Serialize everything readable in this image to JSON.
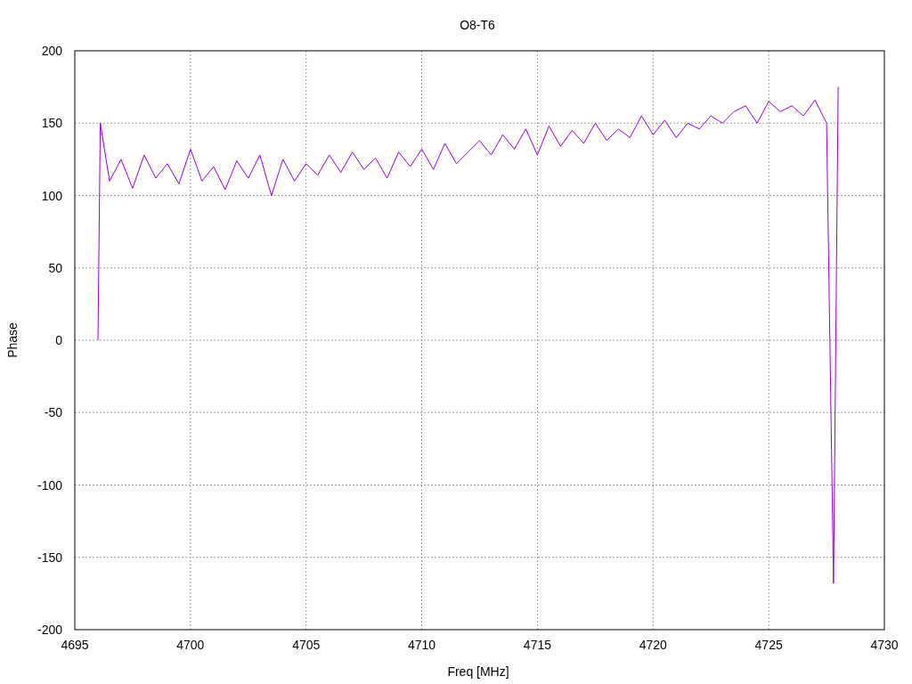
{
  "chart": {
    "chart_data": {
      "type": "line",
      "grid": true,
      "title": "O8-T6",
      "xlabel": "Freq [MHz]",
      "ylabel": "Phase",
      "xlim": [
        4695,
        4730
      ],
      "ylim": [
        -200,
        200
      ],
      "xticks": [
        4695,
        4700,
        4705,
        4710,
        4715,
        4720,
        4725,
        4730
      ],
      "yticks": [
        -200,
        -150,
        -100,
        -50,
        0,
        50,
        100,
        150,
        200
      ],
      "x": [
        4696,
        4696.1,
        4696.5,
        4697,
        4697.5,
        4698,
        4698.5,
        4699,
        4699.5,
        4700,
        4700.5,
        4701,
        4701.5,
        4702,
        4702.5,
        4703,
        4703.5,
        4704,
        4704.5,
        4705,
        4705.5,
        4706,
        4706.5,
        4707,
        4707.5,
        4708,
        4708.5,
        4709,
        4709.5,
        4710,
        4710.5,
        4711,
        4711.5,
        4712,
        4712.5,
        4713,
        4713.5,
        4714,
        4714.5,
        4715,
        4715.5,
        4716,
        4716.5,
        4717,
        4717.5,
        4718,
        4718.5,
        4719,
        4719.5,
        4720,
        4720.5,
        4721,
        4721.5,
        4722,
        4722.5,
        4723,
        4723.5,
        4724,
        4724.5,
        4725,
        4725.5,
        4726,
        4726.5,
        4727,
        4727.5,
        4727.8,
        4728
      ],
      "series": [
        {
          "color": "#9400d3",
          "values": [
            0,
            150,
            110,
            125,
            105,
            128,
            112,
            122,
            108,
            132,
            110,
            120,
            104,
            124,
            112,
            128,
            100,
            125,
            110,
            122,
            114,
            128,
            116,
            130,
            118,
            126,
            112,
            130,
            120,
            132,
            118,
            136,
            122,
            130,
            138,
            128,
            142,
            132,
            146,
            128,
            148,
            134,
            145,
            136,
            150,
            138,
            146,
            140,
            155,
            142,
            152,
            140,
            150,
            146,
            155,
            150,
            158,
            162,
            150,
            165,
            158,
            162,
            155,
            166,
            150,
            -168,
            175
          ]
        }
      ]
    }
  }
}
